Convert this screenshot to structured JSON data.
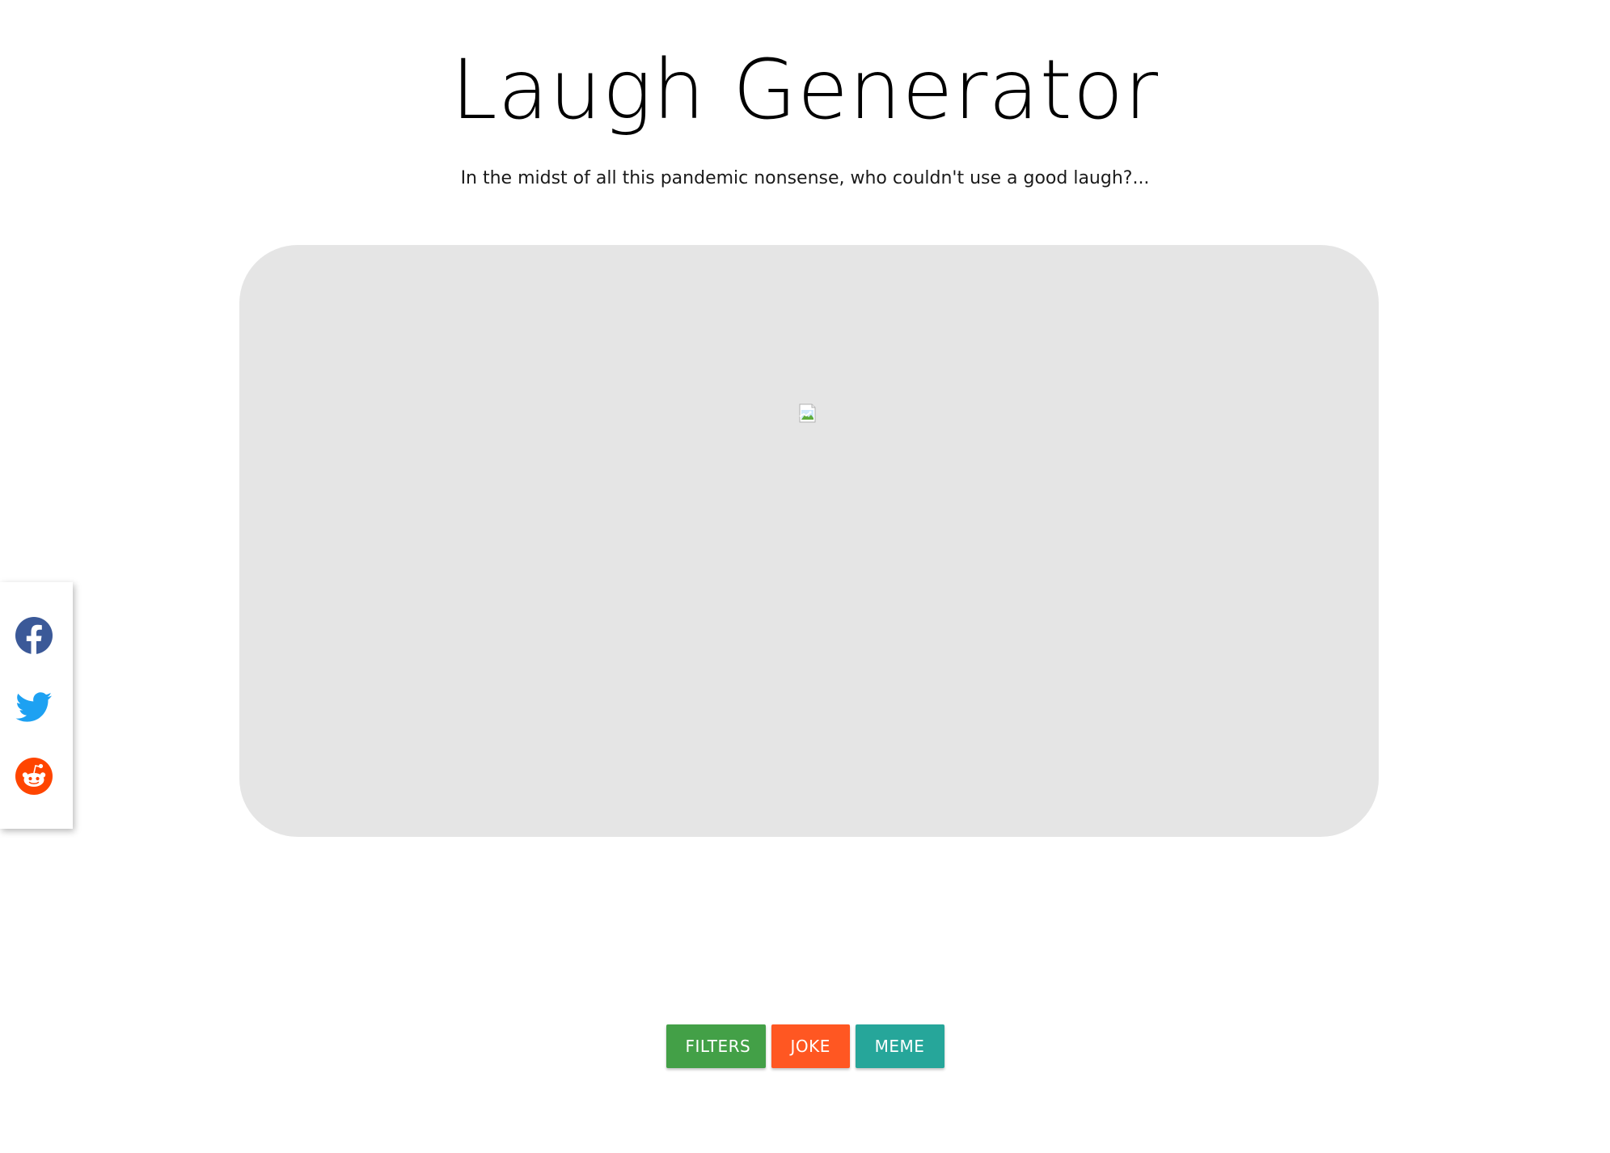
{
  "header": {
    "title": "Laugh Generator",
    "subtitle": "In the midst of all this pandemic nonsense, who couldn't use a good laugh?..."
  },
  "content": {
    "image_state": "broken-image-icon"
  },
  "share": {
    "items": [
      {
        "icon": "facebook-icon",
        "color": "#3b5998"
      },
      {
        "icon": "twitter-icon",
        "color": "#1da1f2"
      },
      {
        "icon": "reddit-icon",
        "color": "#ff4500"
      }
    ]
  },
  "actions": {
    "filters_label": "FILTERS",
    "joke_label": "JOKE",
    "meme_label": "MEME",
    "colors": {
      "filters": "#43a047",
      "joke": "#ff5722",
      "meme": "#26a69a"
    }
  }
}
